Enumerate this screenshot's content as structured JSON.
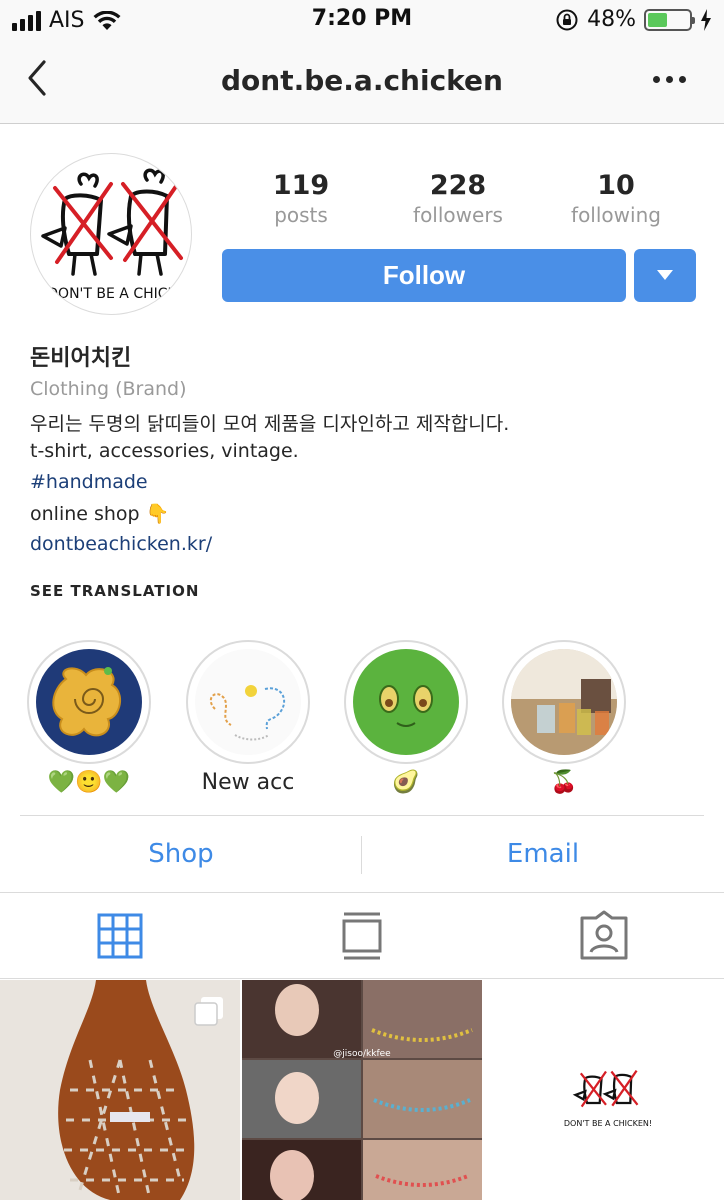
{
  "status_bar": {
    "carrier": "AIS",
    "time": "7:20 PM",
    "battery_percent": "48%",
    "battery_level": 0.48,
    "icons": [
      "signal-icon",
      "wifi-icon",
      "orientation-lock-icon",
      "battery-icon",
      "charging-bolt-icon"
    ]
  },
  "nav": {
    "title": "dont.be.a.chicken",
    "back_icon": "chevron-left-icon",
    "more_icon": "more-dots-icon"
  },
  "profile": {
    "avatar_text": "DON'T BE A CHICK",
    "stats": [
      {
        "num": "119",
        "label": "posts"
      },
      {
        "num": "228",
        "label": "followers"
      },
      {
        "num": "10",
        "label": "following"
      }
    ],
    "follow_label": "Follow",
    "accent": "#4a8fe7"
  },
  "bio": {
    "name": "돈비어치킨",
    "category": "Clothing (Brand)",
    "line1": "우리는 두명의 닭띠들이 모여 제품을 디자인하고 제작합니다.",
    "line2": "t-shirt, accessories, vintage.",
    "hashtag": "#handmade",
    "shop_line": "online shop 👇",
    "link": "dontbeachicken.kr/",
    "translate": "SEE TRANSLATION"
  },
  "highlights": [
    {
      "caption": "💚🙂💚"
    },
    {
      "caption": "New acc"
    },
    {
      "caption": "🥑"
    },
    {
      "caption": "🍒"
    }
  ],
  "actions": {
    "shop": "Shop",
    "email": "Email",
    "color": "#3e8ae6"
  },
  "tabs": [
    {
      "icon": "grid-icon",
      "active": true
    },
    {
      "icon": "feed-list-icon",
      "active": false
    },
    {
      "icon": "tagged-photos-icon",
      "active": false
    }
  ],
  "posts": [
    {
      "icon": "multi-photo-icon"
    },
    {
      "watermark": "@jisoo/kkfee"
    },
    {
      "logo_text": "DON'T BE A CHICKEN!"
    }
  ]
}
